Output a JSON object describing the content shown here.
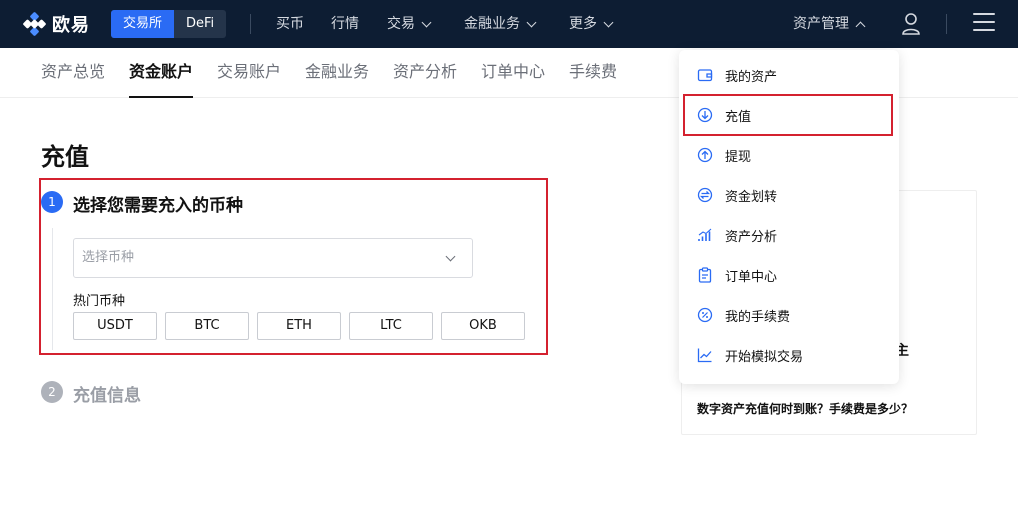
{
  "header": {
    "logo_text": "欧易",
    "segment": [
      "交易所",
      "DeFi"
    ],
    "nav": [
      {
        "label": "买币",
        "has_chevron": false
      },
      {
        "label": "行情",
        "has_chevron": false
      },
      {
        "label": "交易",
        "has_chevron": true
      },
      {
        "label": "金融业务",
        "has_chevron": true
      },
      {
        "label": "更多",
        "has_chevron": true
      }
    ],
    "asset_menu_label": "资产管理"
  },
  "subtabs": [
    "资产总览",
    "资金账户",
    "交易账户",
    "金融业务",
    "资产分析",
    "订单中心",
    "手续费"
  ],
  "active_subtab": "资金账户",
  "main": {
    "title": "充值",
    "step1": {
      "num": "1",
      "title": "选择您需要充入的币种"
    },
    "select_placeholder": "选择币种",
    "hot_label": "热门币种",
    "coins": [
      "USDT",
      "BTC",
      "ETH",
      "LTC",
      "OKB"
    ],
    "step2": {
      "num": "2",
      "title": "充值信息"
    }
  },
  "faq": {
    "partial_char": "主",
    "question": "数字资产充值何时到账？手续费是多少？"
  },
  "dropdown": {
    "items": [
      {
        "label": "我的资产",
        "icon": "wallet-icon"
      },
      {
        "label": "充值",
        "icon": "deposit-icon"
      },
      {
        "label": "提现",
        "icon": "withdraw-icon"
      },
      {
        "label": "资金划转",
        "icon": "transfer-icon"
      },
      {
        "label": "资产分析",
        "icon": "analysis-icon"
      },
      {
        "label": "订单中心",
        "icon": "clipboard-icon"
      },
      {
        "label": "我的手续费",
        "icon": "fee-icon"
      },
      {
        "label": "开始模拟交易",
        "icon": "chart-line-icon"
      }
    ]
  },
  "colors": {
    "header_bg": "#0d1d33",
    "accent": "#2a6bf4",
    "highlight_border": "#d4212f"
  }
}
